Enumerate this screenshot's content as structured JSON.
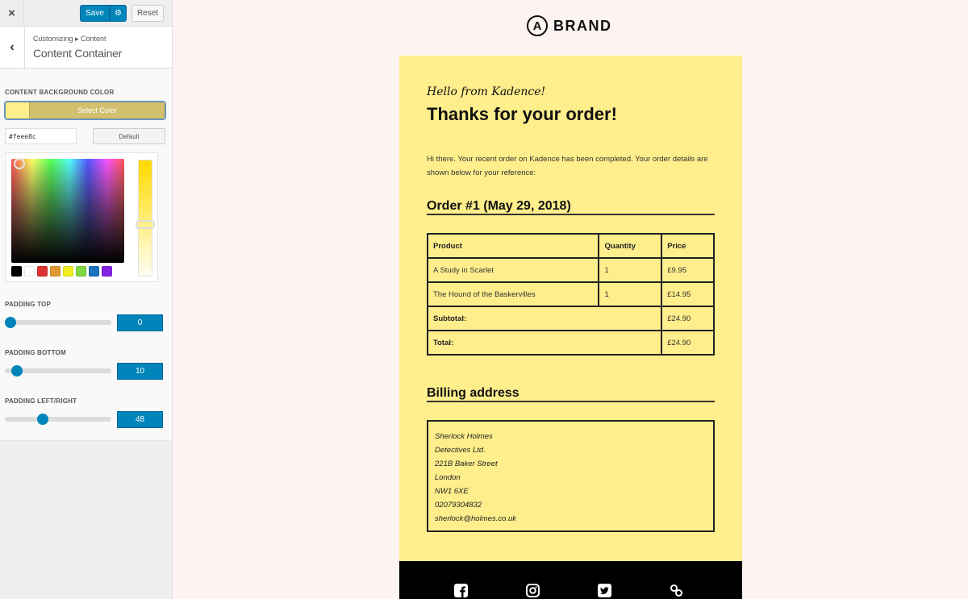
{
  "sidebar": {
    "close_label": "×",
    "save_label": "Save",
    "gear_label": "⚙",
    "reset_label": "Reset",
    "back_label": "‹",
    "breadcrumb": "Customizing ▸ Content",
    "section_title": "Content Container",
    "content_bg": {
      "label": "Content Background Color",
      "select_label": "Select Color",
      "value": "#feee8c",
      "default_label": "Default",
      "palette": [
        "#000000",
        "#ffffff",
        "#dd3333",
        "#dd9933",
        "#eeee22",
        "#81d742",
        "#1e73be",
        "#8224e3"
      ]
    },
    "padding_top": {
      "label": "Padding Top",
      "value": "0",
      "fraction": 0.0
    },
    "padding_bottom": {
      "label": "Padding Bottom",
      "value": "10",
      "fraction": 0.07
    },
    "padding_lr": {
      "label": "Padding Left/Right",
      "value": "48",
      "fraction": 0.34
    }
  },
  "preview": {
    "brand_logo_letter": "A",
    "brand_name": "BRAND",
    "hello": "Hello from Kadence!",
    "heading": "Thanks for your order!",
    "intro": "Hi there. Your recent order on Kadence has been completed. Your order details are shown below for your reference:",
    "order_heading": "Order #1 (May 29, 2018)",
    "table": {
      "headers": [
        "Product",
        "Quantity",
        "Price"
      ],
      "rows": [
        {
          "product": "A Study in Scarlet",
          "quantity": "1",
          "price": "£9.95"
        },
        {
          "product": "The Hound of the Baskervilles",
          "quantity": "1",
          "price": "£14.95"
        }
      ],
      "subtotal_label": "Subtotal:",
      "subtotal": "£24.90",
      "total_label": "Total:",
      "total": "£24.90"
    },
    "billing_heading": "Billing address",
    "address": [
      "Sherlock Holmes",
      "Detectives Ltd.",
      "221B Baker Street",
      "London",
      "NW1 6XE",
      "02079304832",
      "sherlock@holmes.co.uk"
    ],
    "social": [
      "facebook",
      "instagram",
      "twitter",
      "link"
    ],
    "colors": {
      "content_bg": "#feee8c",
      "footer_bg": "#000000",
      "accent": "#0085ba"
    }
  }
}
